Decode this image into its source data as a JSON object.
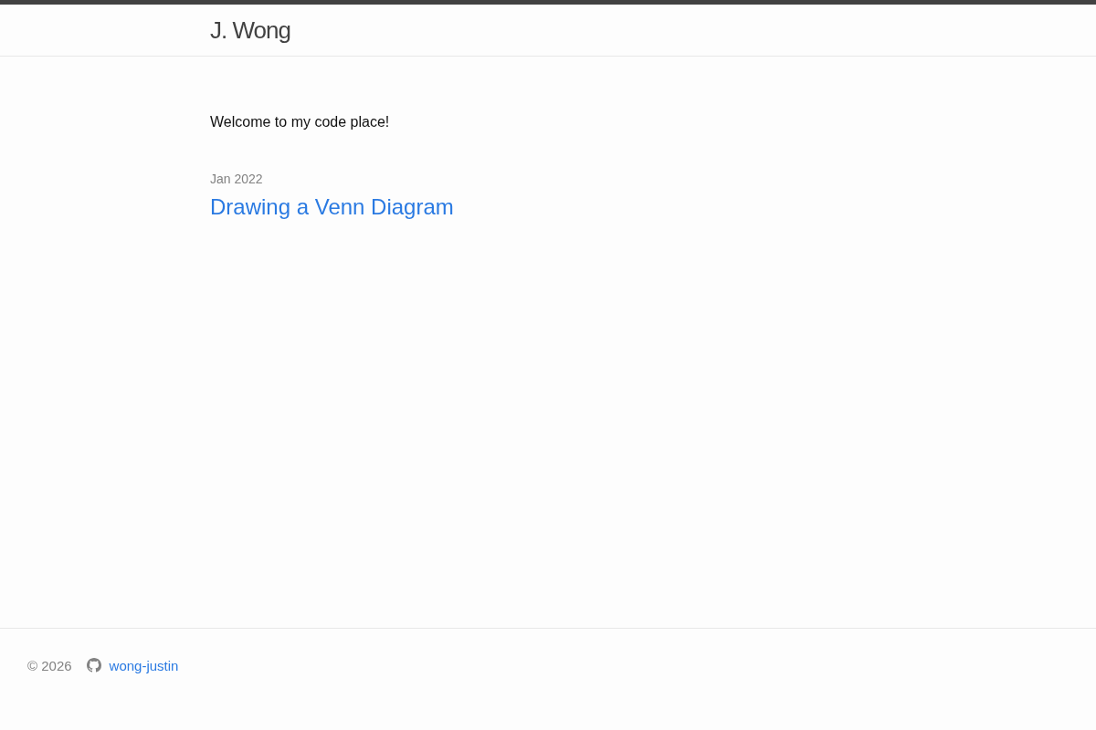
{
  "header": {
    "site_title": "J. Wong"
  },
  "intro": "Welcome to my code place!",
  "posts": [
    {
      "date": "Jan 2022",
      "title": "Drawing a Venn Diagram"
    }
  ],
  "footer": {
    "copyright": "© 2026",
    "username": "wong-justin"
  }
}
